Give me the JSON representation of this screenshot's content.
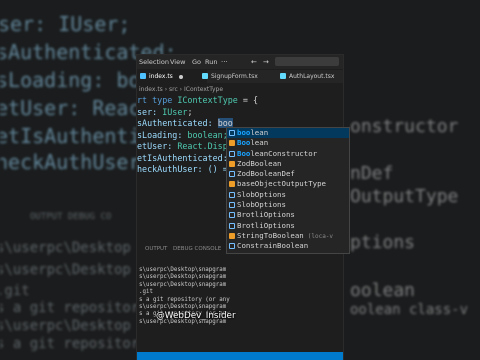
{
  "background": {
    "left_lines": [
      {
        "pre": "",
        "text": "ser: IUser;"
      },
      {
        "pre": "",
        "text": "sAuthenticated:"
      },
      {
        "pre": "",
        "text": "sLoading: boo"
      },
      {
        "pre": "",
        "text": "etUser: React."
      },
      {
        "pre": "",
        "text": "etIsAuthenti"
      },
      {
        "pre": "",
        "text": "heckAuthUser"
      }
    ],
    "terminal_lines": [
      "OUTPUT    DEBUG CO",
      "s\\userpc\\Desktop",
      "s\\userpc\\Desktop",
      ".git",
      "s a git repositor",
      "s\\userpc\\Desktop",
      "s a git repositor",
      "s\\userpc\\Desktop"
    ],
    "right_lines": [
      "onstructor",
      "nDef",
      "OutputType",
      "ptions",
      "oolean",
      "oolean  class-v"
    ]
  },
  "menubar": {
    "items": [
      "Selection",
      "View",
      "Go",
      "Run"
    ],
    "back_icon": "←",
    "forward_icon": "→"
  },
  "tabs": [
    {
      "label": "index.ts",
      "dirty": true,
      "active": true
    },
    {
      "label": "SignupForm.tsx",
      "dirty": false,
      "active": false
    },
    {
      "label": "AuthLayout.tsx",
      "dirty": false,
      "active": false
    }
  ],
  "breadcrumb": "index.ts › src › IContextType",
  "code": {
    "line1_kw": "rt type ",
    "line1_ty": "IContextType",
    "line1_rest": " = {",
    "line2_pr": "ser: ",
    "line2_ty": "IUser",
    "line3_pr": "sAuthenticated: ",
    "line3_typed": "boo",
    "line4_pr": "sLoading: ",
    "line4_ty": "boolean;",
    "line5_pr": "etUser: ",
    "line5_ty": "React.Dispa",
    "line6_pr": "etIsAuthenticated: ",
    "line7_pr": "heckAuthUser: () =>"
  },
  "suggestions": [
    {
      "match": "boo",
      "rest": "lean",
      "kind": "intf",
      "selected": true,
      "detail": ""
    },
    {
      "match": "Boo",
      "rest": "lean",
      "kind": "class",
      "selected": false,
      "detail": ""
    },
    {
      "match": "Boo",
      "rest": "leanConstructor",
      "kind": "intf",
      "selected": false,
      "detail": ""
    },
    {
      "match": "",
      "rest": "ZodBoolean",
      "kind": "class",
      "selected": false,
      "detail": ""
    },
    {
      "match": "",
      "rest": "ZodBooleanDef",
      "kind": "intf",
      "selected": false,
      "detail": ""
    },
    {
      "match": "",
      "rest": "baseObjectOutputType",
      "kind": "class",
      "selected": false,
      "detail": ""
    },
    {
      "match": "",
      "rest": "SlobOptions",
      "kind": "intf",
      "selected": false,
      "detail": ""
    },
    {
      "match": "",
      "rest": "SlobOptions",
      "kind": "intf",
      "selected": false,
      "detail": ""
    },
    {
      "match": "",
      "rest": "BrotliOptions",
      "kind": "intf",
      "selected": false,
      "detail": ""
    },
    {
      "match": "",
      "rest": "BrotliOptions",
      "kind": "intf",
      "selected": false,
      "detail": ""
    },
    {
      "match": "",
      "rest": "StringToBoolean",
      "kind": "class",
      "selected": false,
      "detail": "(loca-v"
    },
    {
      "match": "",
      "rest": "ConstrainBoolean",
      "kind": "intf",
      "selected": false,
      "detail": ""
    }
  ],
  "panel": {
    "tabs": [
      "OUTPUT",
      "DEBUG CONSOLE"
    ],
    "terminal_lines": [
      "s\\userpc\\Desktop\\snapgram",
      "s\\userpc\\Desktop\\snapgram",
      "s\\userpc\\Desktop\\snapgram",
      ".git",
      "s a git repository (or any",
      "s\\userpc\\Desktop\\snapgram",
      "s a git repository (or any",
      "s\\userpc\\Desktop\\snapgram"
    ]
  },
  "watermark": "@WebDev_Insider",
  "colors": {
    "accent": "#007acc",
    "selection": "#04395e",
    "match": "#18a3ff"
  }
}
